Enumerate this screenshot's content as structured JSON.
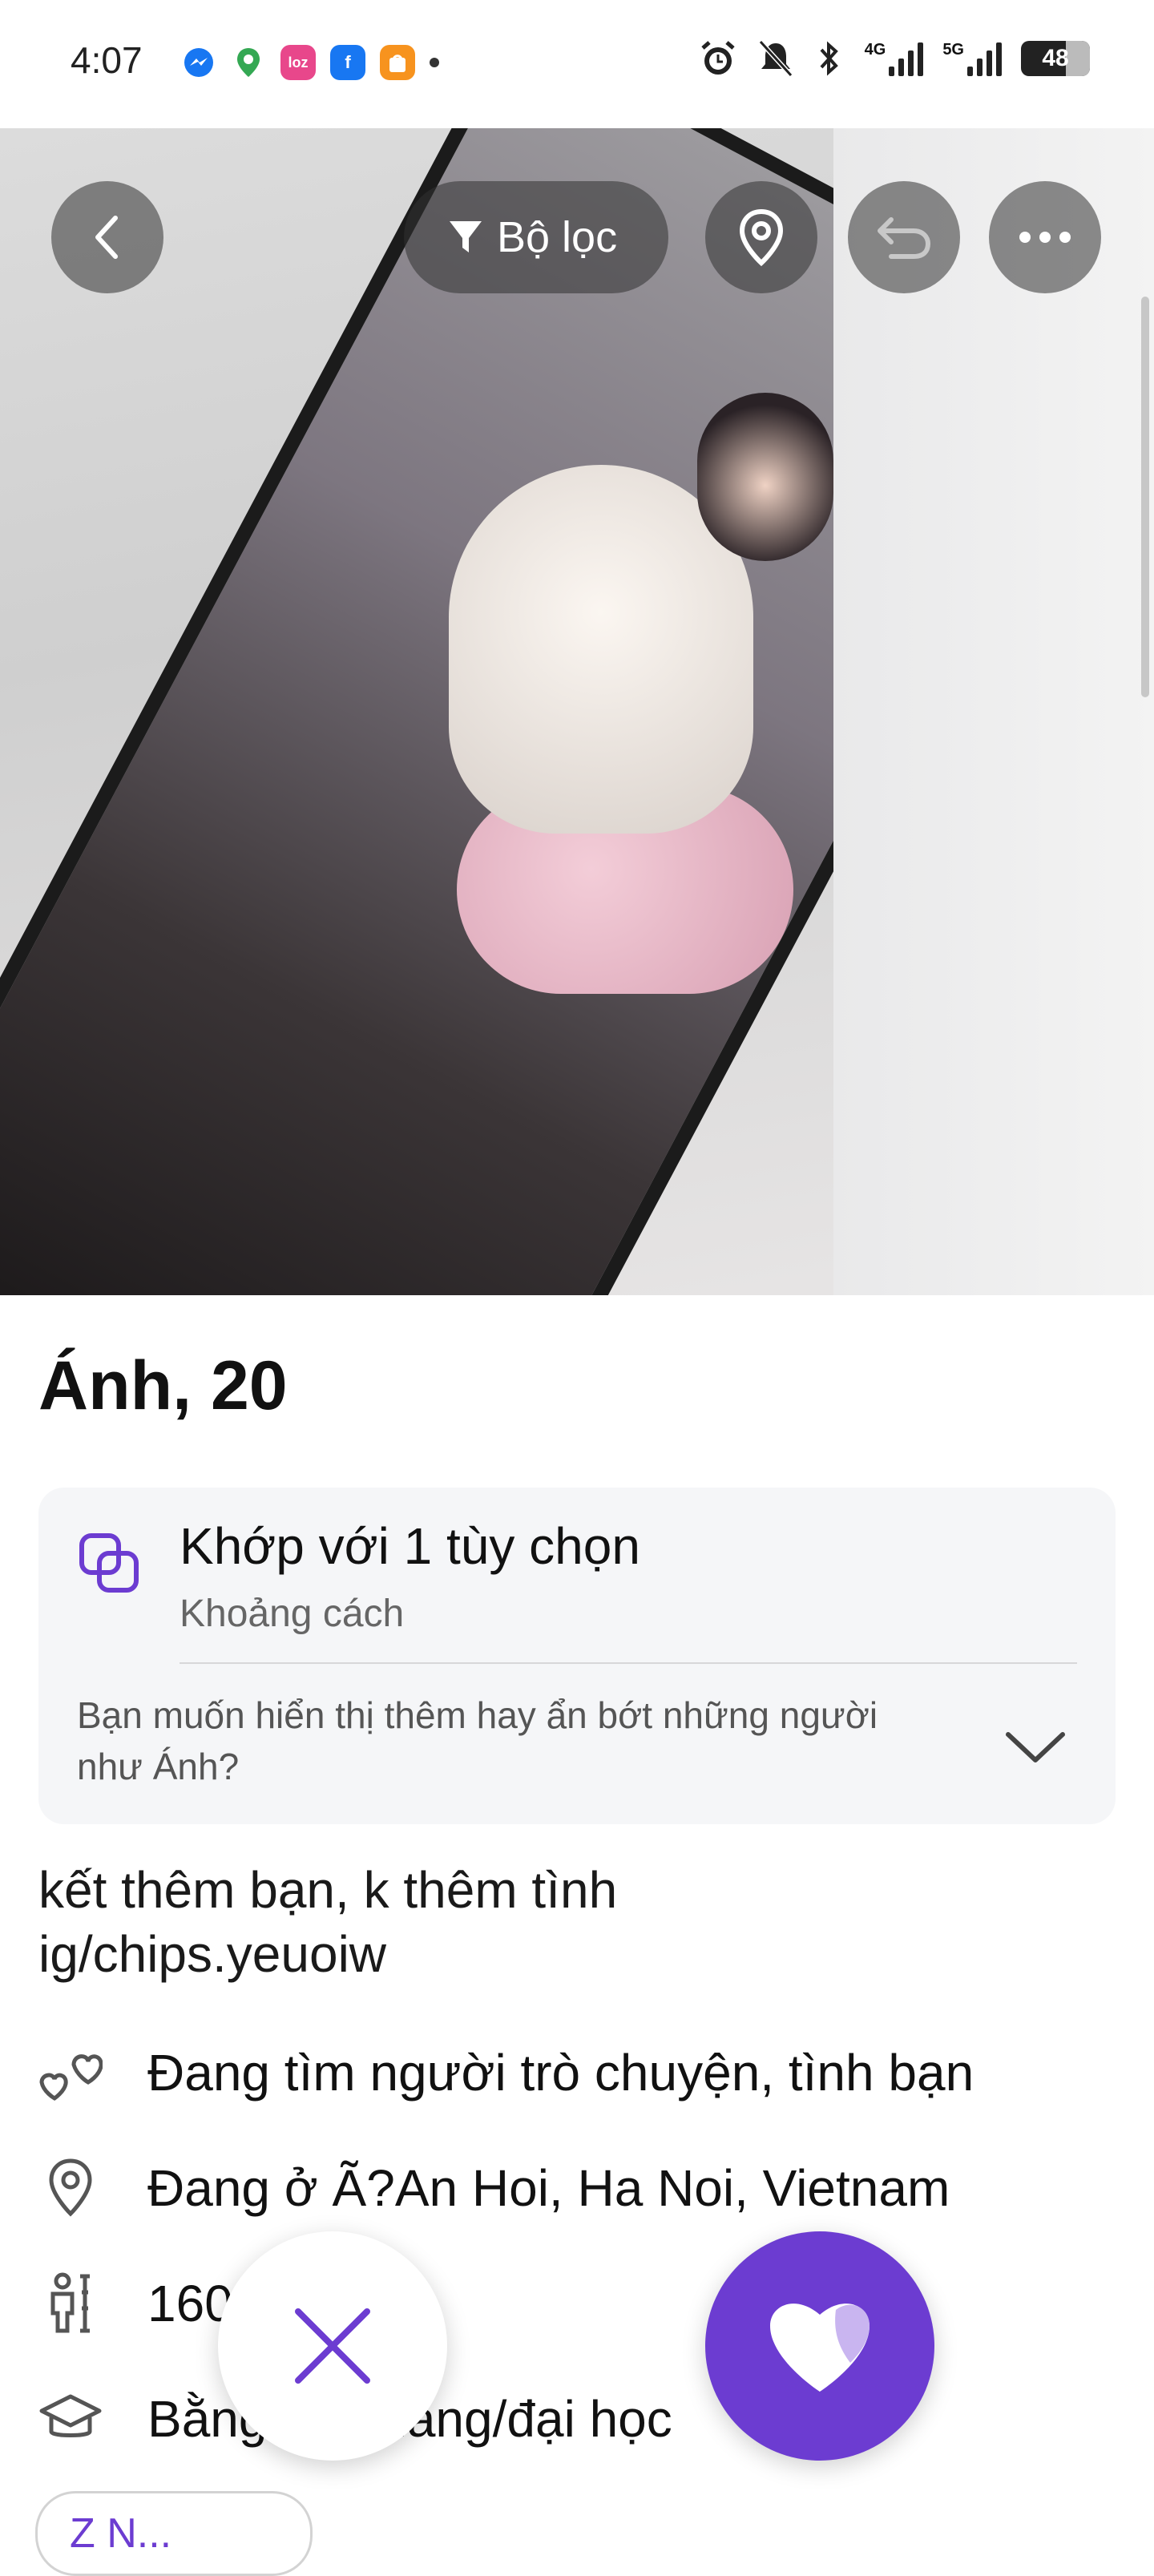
{
  "status_bar": {
    "time": "4:07",
    "battery": "48",
    "network_4g": "4G",
    "network_5g": "5G",
    "notif_app_label": "loz"
  },
  "top_bar": {
    "filter_label": "Bộ lọc"
  },
  "profile": {
    "name_age": "Ánh, 20"
  },
  "match_card": {
    "title": "Khớp với 1 tùy chọn",
    "subtitle": "Khoảng cách",
    "question": "Bạn muốn hiển thị thêm hay ẩn bớt những người như Ánh?"
  },
  "bio": {
    "line1": "kết thêm bạn, k thêm tình",
    "line2": "ig/chips.yeuoiw"
  },
  "details": {
    "looking_for": "Đang tìm người trò chuyện, tình bạn",
    "location": "Đang ở Ã?An Hoi, Ha Noi, Vietnam",
    "height": "160",
    "education": "Bằng cao đẳng/đại học"
  },
  "bottom_pill": {
    "label": "Z N..."
  },
  "colors": {
    "accent": "#6c3cd1"
  }
}
